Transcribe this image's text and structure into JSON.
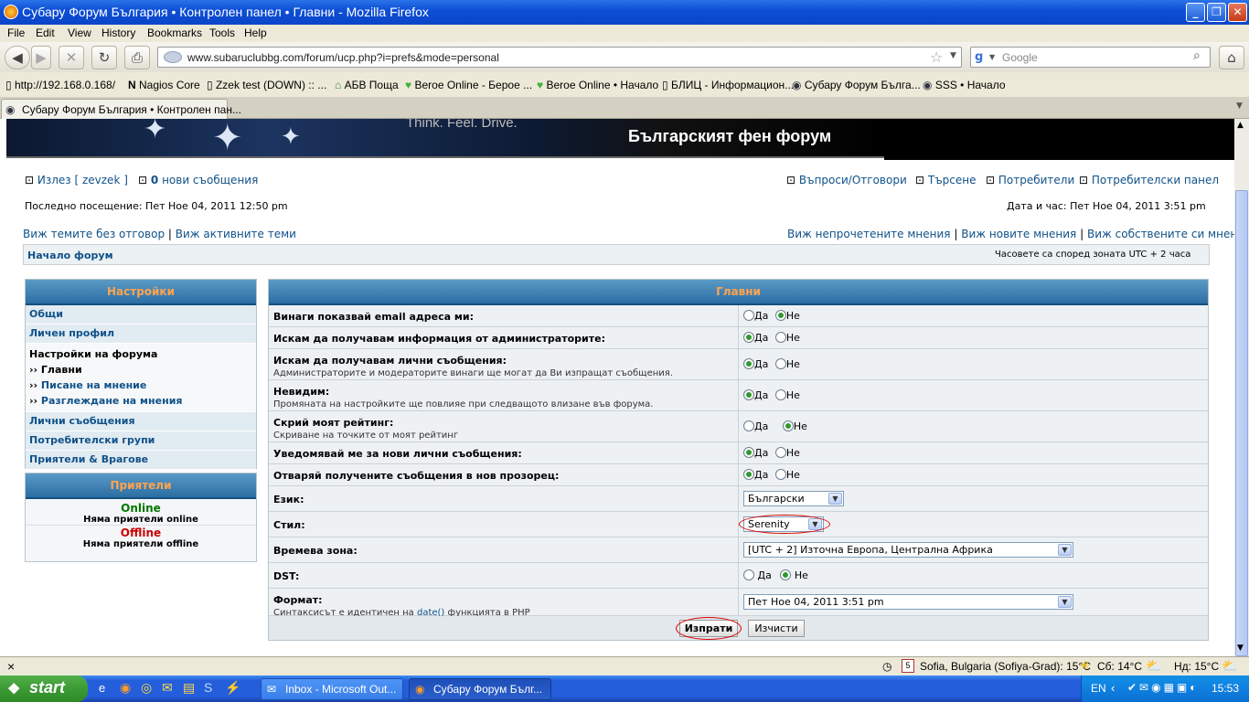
{
  "window": {
    "title": "Субару Форум България • Контролен панел • Главни - Mozilla Firefox"
  },
  "menu": [
    "File",
    "Edit",
    "View",
    "History",
    "Bookmarks",
    "Tools",
    "Help"
  ],
  "nav": {
    "url": "www.subaruclubbg.com/forum/ucp.php?i=prefs&mode=personal",
    "search_placeholder": "Google"
  },
  "bookmarks": [
    "http://192.168.0.168/",
    "Nagios Core",
    "Zzek test (DOWN) :: ...",
    "АБВ Поща",
    "Beroe Online - Берое ...",
    "Beroe Online • Начало",
    "БЛИЦ - Информацион...",
    "Субару Форум Бълга...",
    "SSS • Начало"
  ],
  "tab": {
    "label": "Субару Форум България • Контролен пан..."
  },
  "banner": {
    "tagline": "Think. Feel. Drive.",
    "subtitle": "Българският фен форум"
  },
  "header": {
    "logout": "Излез [ zevzek ]",
    "new_messages_count": "0",
    "new_messages_label": "нови съобщения",
    "faq": "Въпроси/Отговори",
    "search": "Търсене",
    "members": "Потребители",
    "ucp": "Потребителски панел",
    "last_visit": "Последно посещение: Пет Ное 04, 2011 12:50 pm",
    "datetime": "Дата и час: Пет Ное 04, 2011 3:51 pm",
    "unanswered": "Виж темите без отговор",
    "active": "Виж активните теми",
    "unread": "Виж непрочетените мнения",
    "newposts": "Виж новите мнения",
    "own": "Виж собствените си мнения",
    "sep": "|",
    "forum_index": "Начало форум",
    "timezone_note": "Часовете са според зоната UTC + 2 часа"
  },
  "sidebar": {
    "title": "Настройки",
    "general": "Общи",
    "profile": "Личен профил",
    "board_prefs": "Настройки на форума",
    "sub_general": "Главни",
    "sub_posting": "Писане на мнение",
    "sub_viewing": "Разглеждане на мнения",
    "pm": "Лични съобщения",
    "groups": "Потребителски групи",
    "friends_foes": "Приятели & Врагове",
    "sub_marker": "››"
  },
  "friends": {
    "title": "Приятели",
    "online": "Online",
    "no_online": "Няма приятели online",
    "offline": "Offline",
    "no_offline": "Няма приятели offline"
  },
  "form": {
    "title": "Главни",
    "yes": "Да",
    "no": "Не",
    "rows": [
      {
        "label": "Винаги показвай email адреса ми:",
        "value": "Не"
      },
      {
        "label": "Искам да получавам информация от администраторите:",
        "value": "Да"
      },
      {
        "label": "Искам да получавам лични съобщения:",
        "desc": "Администраторите и модераторите винаги ще могат да Ви изпращат съобщения.",
        "value": "Да"
      },
      {
        "label": "Невидим:",
        "desc": "Промяната на настройките ще повлияе при следващото влизане във форума.",
        "value": "Да"
      },
      {
        "label": "Скрий моят рейтинг:",
        "desc": "Скриване на точките от моят рейтинг",
        "value": "Не"
      },
      {
        "label": "Уведомявай ме за нови лични съобщения:",
        "value": "Да"
      },
      {
        "label": "Отваряй получените съобщения в нов прозорец:",
        "value": "Да"
      }
    ],
    "language_label": "Език:",
    "language_value": "Български",
    "style_label": "Стил:",
    "style_value": "Serenity",
    "tz_label": "Времева зона:",
    "tz_value": "[UTC + 2] Източна Европа, Централна Африка",
    "dst_label": "DST:",
    "dst_value": "Не",
    "format_label": "Формат:",
    "format_desc_pre": "Синтаксисът е идентичен на",
    "format_desc_link": "date()",
    "format_desc_post": "функцията в PHP",
    "format_value": "Пет Ное 04, 2011 3:51 pm",
    "submit": "Изпрати",
    "reset": "Изчисти"
  },
  "statusbar": {
    "close": "×",
    "weather": "Sofia, Bulgaria (Sofiya-Grad): 15°C",
    "sat": "Сб: 14°C",
    "sun": "Нд: 15°C",
    "calendar_day": "5"
  },
  "taskbar": {
    "start": "start",
    "tasks": [
      "Inbox - Microsoft Out...",
      "Субару Форум Бълг..."
    ],
    "lang": "EN",
    "clock": "15:53"
  },
  "colors": {
    "link": "#105289",
    "accent_head": "#ffa34f",
    "online": "#007700",
    "offline": "#cc0000",
    "xp_blue": "#245edb"
  }
}
